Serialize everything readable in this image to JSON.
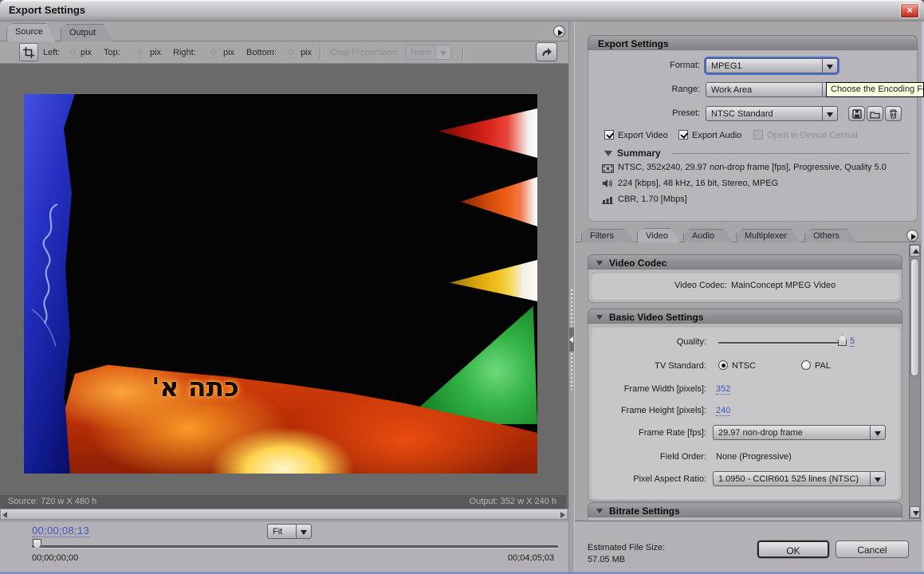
{
  "window": {
    "title": "Export Settings"
  },
  "left_panel": {
    "tabs": [
      {
        "label": "Source",
        "active": true
      },
      {
        "label": "Output",
        "active": false
      }
    ],
    "crop_toolbar": {
      "fields": [
        {
          "label": "Left:",
          "value": "0",
          "unit": "pix"
        },
        {
          "label": "Top:",
          "value": "0",
          "unit": "pix"
        },
        {
          "label": "Right:",
          "value": "0",
          "unit": "pix"
        },
        {
          "label": "Bottom:",
          "value": "0",
          "unit": "pix"
        }
      ],
      "crop_proportions_label": "Crop Proportions:",
      "crop_proportions_value": "None"
    },
    "preview": {
      "hebrew_text": "כתה א'"
    },
    "status": {
      "source": "Source: 720 w X 480 h",
      "output": "Output: 352 w X 240 h"
    },
    "transport": {
      "current_time": "00;00;08;13",
      "zoom_level": "Fit",
      "start_time": "00;00;00;00",
      "end_time": "00;04;05;03"
    }
  },
  "right_panel": {
    "export_settings": {
      "title": "Export Settings",
      "format_label": "Format:",
      "format_value": "MPEG1",
      "range_label": "Range:",
      "range_value": "Work Area",
      "preset_label": "Preset:",
      "preset_value": "NTSC Standard",
      "export_video_label": "Export Video",
      "export_video_checked": true,
      "export_audio_label": "Export Audio",
      "export_audio_checked": true,
      "device_central_label": "Open in Device Central",
      "device_central_checked": false,
      "summary_label": "Summary",
      "summary_video": "NTSC, 352x240, 29.97 non-drop frame [fps], Progressive, Quality 5.0",
      "summary_audio": "224 [kbps], 48 kHz, 16 bit, Stereo, MPEG",
      "summary_bitrate": "CBR, 1.70 [Mbps]"
    },
    "tooltip": "Choose the Encoding For",
    "tabs": [
      {
        "label": "Filters"
      },
      {
        "label": "Video",
        "active": true
      },
      {
        "label": "Audio"
      },
      {
        "label": "Multiplexer"
      },
      {
        "label": "Others"
      }
    ],
    "video_codec": {
      "title": "Video Codec",
      "codec_label": "Video Codec:",
      "codec_value": "MainConcept MPEG Video"
    },
    "basic_video": {
      "title": "Basic Video Settings",
      "quality_label": "Quality:",
      "quality_value": "5",
      "tv_standard_label": "TV Standard:",
      "ntsc_label": "NTSC",
      "pal_label": "PAL",
      "tv_standard_selected": "NTSC",
      "frame_width_label": "Frame Width [pixels]:",
      "frame_width_value": "352",
      "frame_height_label": "Frame Height [pixels]:",
      "frame_height_value": "240",
      "frame_rate_label": "Frame Rate [fps]:",
      "frame_rate_value": "29.97 non-drop frame",
      "field_order_label": "Field Order:",
      "field_order_value": "None (Progressive)",
      "par_label": "Pixel Aspect Ratio:",
      "par_value": "1.0950 - CCIR601 525 lines (NTSC)"
    },
    "bitrate_settings": {
      "title": "Bitrate Settings"
    },
    "footer": {
      "estimated_label": "Estimated File Size:",
      "estimated_value": "57.05 MB",
      "ok_label": "OK",
      "cancel_label": "Cancel"
    }
  }
}
